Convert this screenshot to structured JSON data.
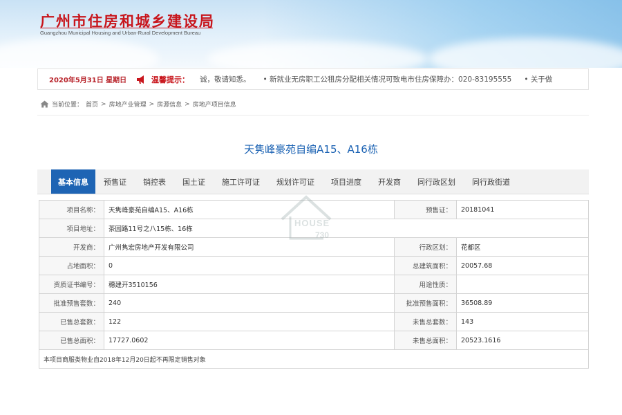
{
  "header": {
    "title_cn": "广州市住房和城乡建设局",
    "title_en": "Guangzhou Municipal Housing and Urban-Rural Development Bureau"
  },
  "notice": {
    "date": "2020年5月31日 星期日",
    "tip_label": "温馨提示：",
    "items": [
      "诚，敬请知悉。",
      "• 新就业无房职工公租房分配相关情况可致电市住房保障办：020-83195555",
      "• 关于做"
    ]
  },
  "breadcrumb": {
    "prefix": "当前位置：",
    "items": [
      "首页",
      "房地产业管理",
      "房源信息",
      "房地产项目信息"
    ],
    "separator": ">"
  },
  "project": {
    "title": "天隽峰豪苑自编A15、A16栋"
  },
  "tabs": [
    {
      "label": "基本信息",
      "active": true
    },
    {
      "label": "预售证",
      "active": false
    },
    {
      "label": "销控表",
      "active": false
    },
    {
      "label": "国土证",
      "active": false
    },
    {
      "label": "施工许可证",
      "active": false
    },
    {
      "label": "规划许可证",
      "active": false
    },
    {
      "label": "项目进度",
      "active": false
    },
    {
      "label": "开发商",
      "active": false
    },
    {
      "label": "同行政区划",
      "active": false
    },
    {
      "label": "同行政街道",
      "active": false
    }
  ],
  "info": {
    "project_name_label": "项目名称：",
    "project_name": "天隽峰豪苑自编A15、A16栋",
    "presale_label": "预售证：",
    "presale": "20181041",
    "address_label": "项目地址：",
    "address": "茶园路11号之八15栋、16栋",
    "developer_label": "开发商：",
    "developer": "广州隽宏房地产开发有限公司",
    "district_label": "行政区划：",
    "district": "花都区",
    "land_area_label": "占地面积：",
    "land_area": "0",
    "build_area_label": "总建筑面积：",
    "build_area": "20057.68",
    "cert_label": "资质证书编号：",
    "cert": "穗建开3510156",
    "usage_label": "用途性质：",
    "usage": "",
    "approved_units_label": "批准预售套数：",
    "approved_units": "240",
    "approved_area_label": "批准预售面积：",
    "approved_area": "36508.89",
    "sold_units_label": "已售总套数：",
    "sold_units": "122",
    "unsold_units_label": "未售总套数：",
    "unsold_units": "143",
    "sold_area_label": "已售总面积：",
    "sold_area": "17727.0602",
    "unsold_area_label": "未售总面积：",
    "unsold_area": "20523.1616",
    "note": "本项目商服类物业自2018年12月20日起不再限定销售对象"
  },
  "watermark": {
    "line1": "HOUSE",
    "line2": "730"
  },
  "colors": {
    "brand_red": "#c8161d",
    "tab_active_bg": "#1e64b4",
    "title_blue": "#1e64b4"
  }
}
